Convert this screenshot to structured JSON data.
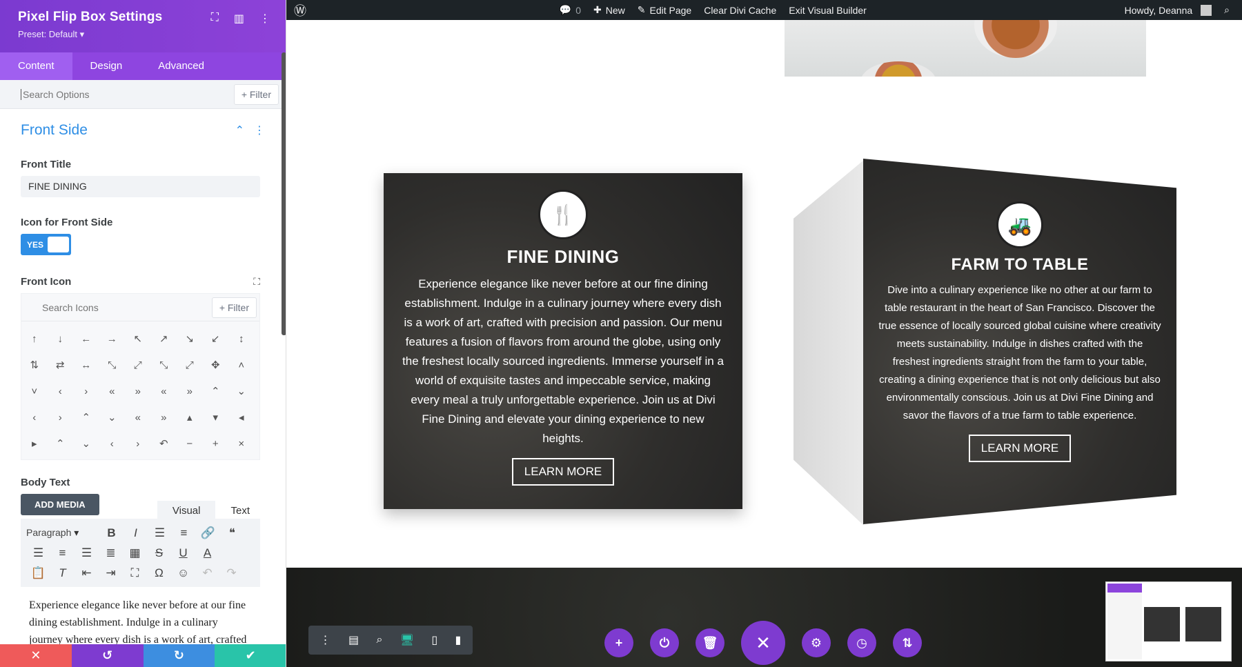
{
  "panel": {
    "title": "Pixel Flip Box Settings",
    "preset": "Preset: Default ▾",
    "tabs": [
      "Content",
      "Design",
      "Advanced"
    ],
    "search_placeholder": "Search Options",
    "filter_label": "+ Filter",
    "section_title": "Front Side",
    "front_title_label": "Front Title",
    "front_title_value": "FINE DINING",
    "icon_toggle_label": "Icon for Front Side",
    "toggle_value": "YES",
    "front_icon_label": "Front Icon",
    "icon_search_placeholder": "Search Icons",
    "icon_filter_label": "+ Filter",
    "icons": [
      "↑",
      "↓",
      "←",
      "→",
      "↖",
      "↗",
      "↘",
      "↙",
      "↕",
      "⇅",
      "⇄",
      "↔",
      "⤡",
      "⤢",
      "⤡",
      "⤢",
      "✥",
      "˄",
      "˅",
      "‹",
      "›",
      "«",
      "»",
      "«",
      "»",
      "⌃",
      "⌄",
      "‹",
      "›",
      "⌃",
      "⌄",
      "«",
      "»",
      "▴",
      "▾",
      "◂",
      "▸",
      "⌃",
      "⌄",
      "‹",
      "›",
      "↶",
      "−",
      "+",
      "×"
    ],
    "body_text_label": "Body Text",
    "add_media_label": "ADD MEDIA",
    "editor_tabs": [
      "Visual",
      "Text"
    ],
    "paragraph_label": "Paragraph",
    "body_text_value": "Experience elegance like never before at our fine dining establishment. Indulge in a culinary journey where every dish is a work of art, crafted with precision and passion."
  },
  "adminbar": {
    "comments_count": "0",
    "new_label": "New",
    "edit_page_label": "Edit Page",
    "clear_cache_label": "Clear Divi Cache",
    "exit_vb_label": "Exit Visual Builder",
    "howdy": "Howdy, Deanna"
  },
  "cards": [
    {
      "title": "FINE DINING",
      "body": "Experience elegance like never before at our fine dining establishment. Indulge in a culinary journey where every dish is a work of art, crafted with precision and passion. Our menu features a fusion of flavors from around the globe, using only the freshest locally sourced ingredients. Immerse yourself in a world of exquisite tastes and impeccable service, making every meal a truly unforgettable experience. Join us at Divi Fine Dining and elevate your dining experience to new heights.",
      "button": "LEARN MORE",
      "icon": "utensils-icon"
    },
    {
      "title": "FARM TO TABLE",
      "body": "Dive into a culinary experience like no other at our farm to table restaurant in the heart of San Francisco. Discover the true essence of locally sourced global cuisine where creativity meets sustainability. Indulge in dishes crafted with the freshest ingredients straight from the farm to your table, creating a dining experience that is not only delicious but also environmentally conscious. Join us at Divi Fine Dining and savor the flavors of a true farm to table experience.",
      "button": "LEARN MORE",
      "icon": "tractor-icon"
    }
  ],
  "colors": {
    "purple": "#7e3bd0",
    "blue": "#2e8ee5",
    "footer_red": "#ef5a5a",
    "footer_purple": "#7e3bd0",
    "footer_blue": "#3d8ee0",
    "footer_green": "#29c4a9"
  }
}
